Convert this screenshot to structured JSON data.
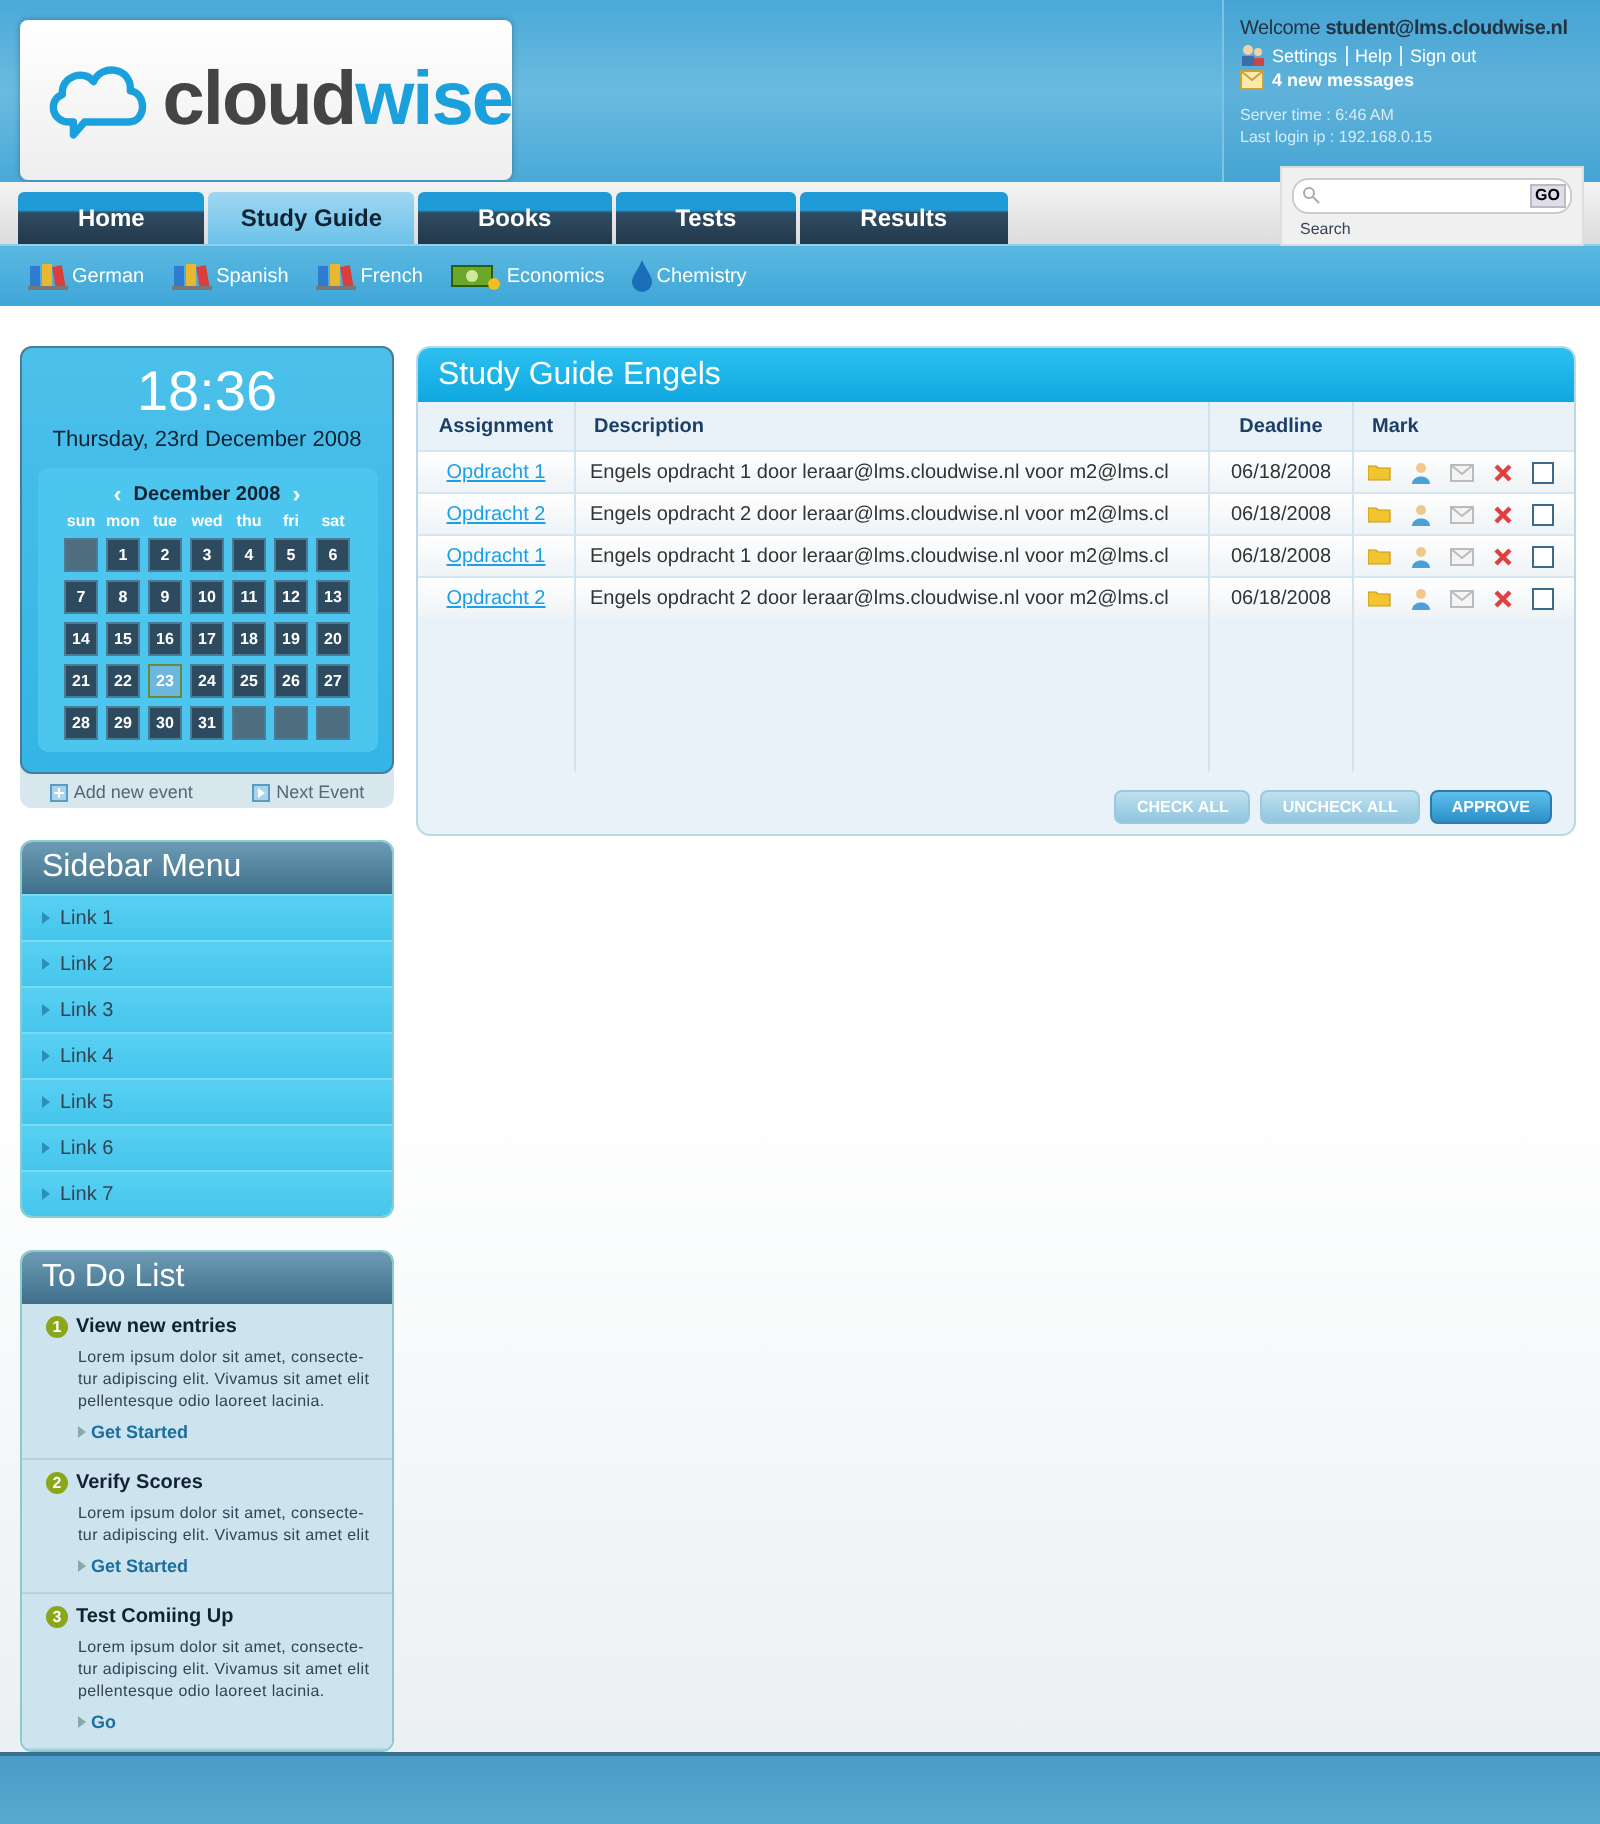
{
  "logo": {
    "part_1": "cloud",
    "part_2": "wise"
  },
  "user_panel": {
    "welcome": "Welcome",
    "user": "student@lms.cloudwise.nl",
    "links": [
      "Settings",
      "Help",
      "Sign out"
    ],
    "messages": "4 new messages",
    "server_time": "Server time : 6:46 AM",
    "last_login": "Last login ip : 192.168.0.15"
  },
  "search": {
    "button": "GO",
    "label": "Search"
  },
  "tabs": [
    {
      "label": "Home",
      "selected": false
    },
    {
      "label": "Study Guide",
      "selected": true
    },
    {
      "label": "Books",
      "selected": false
    },
    {
      "label": "Tests",
      "selected": false
    },
    {
      "label": "Results",
      "selected": false
    }
  ],
  "subjects": [
    {
      "label": "German",
      "kind": "books"
    },
    {
      "label": "Spanish",
      "kind": "books"
    },
    {
      "label": "French",
      "kind": "books"
    },
    {
      "label": "Economics",
      "kind": "money"
    },
    {
      "label": "Chemistry",
      "kind": "drop"
    }
  ],
  "clock": {
    "time": "18:36",
    "date": "Thursday, 23rd December 2008"
  },
  "calendar": {
    "prev": "‹",
    "month": "December 2008",
    "next": "›",
    "weekdays": [
      "sun",
      "mon",
      "tue",
      "wed",
      "thu",
      "fri",
      "sat"
    ],
    "days": [
      {
        "selected": false
      },
      {
        "day": "1",
        "selected": false
      },
      {
        "day": "2",
        "selected": false
      },
      {
        "day": "3",
        "selected": false
      },
      {
        "day": "4",
        "selected": false
      },
      {
        "day": "5",
        "selected": false
      },
      {
        "day": "6",
        "selected": false
      },
      {
        "day": "7",
        "selected": false
      },
      {
        "day": "8",
        "selected": false
      },
      {
        "day": "9",
        "selected": false
      },
      {
        "day": "10",
        "selected": false
      },
      {
        "day": "11",
        "selected": false
      },
      {
        "day": "12",
        "selected": false
      },
      {
        "day": "13",
        "selected": false
      },
      {
        "day": "14",
        "selected": false
      },
      {
        "day": "15",
        "selected": false
      },
      {
        "day": "16",
        "selected": false
      },
      {
        "day": "17",
        "selected": false
      },
      {
        "day": "18",
        "selected": false
      },
      {
        "day": "19",
        "selected": false
      },
      {
        "day": "20",
        "selected": false
      },
      {
        "day": "21",
        "selected": false
      },
      {
        "day": "22",
        "selected": false
      },
      {
        "day": "23",
        "selected": true
      },
      {
        "day": "24",
        "selected": false
      },
      {
        "day": "25",
        "selected": false
      },
      {
        "day": "26",
        "selected": false
      },
      {
        "day": "27",
        "selected": false
      },
      {
        "day": "28",
        "selected": false
      },
      {
        "day": "29",
        "selected": false
      },
      {
        "day": "30",
        "selected": false
      },
      {
        "day": "31",
        "selected": false
      },
      {
        "selected": false
      },
      {
        "selected": false
      },
      {
        "selected": false
      }
    ],
    "actions": [
      "Add new event",
      "Next Event"
    ]
  },
  "sidebar_menu": {
    "title": "Sidebar Menu",
    "items": [
      "Link 1",
      "Link 2",
      "Link 3",
      "Link 4",
      "Link 5",
      "Link 6",
      "Link 7"
    ]
  },
  "todo": {
    "title": "To Do List",
    "items": [
      {
        "number": "1",
        "title": "View new entries",
        "lines": [
          "Lorem ipsum dolor sit amet, consecte-",
          "tur adipiscing elit. Vivamus sit amet elit",
          "pellentesque odio laoreet lacinia."
        ],
        "link": "Get Started"
      },
      {
        "number": "2",
        "title": "Verify Scores",
        "lines": [
          "Lorem ipsum dolor sit amet, consecte-",
          "tur adipiscing elit. Vivamus sit amet elit"
        ],
        "link": "Get Started"
      },
      {
        "number": "3",
        "title": "Test Comiing Up",
        "lines": [
          "Lorem ipsum dolor sit amet, consecte-",
          "tur adipiscing elit. Vivamus sit amet elit",
          "pellentesque odio laoreet lacinia."
        ],
        "link": "Go"
      }
    ]
  },
  "study_guide": {
    "title": "Study Guide Engels",
    "columns": [
      "Assignment",
      "Description",
      "Deadline",
      "Mark"
    ],
    "rows": [
      {
        "assignment": "Opdracht 1",
        "description": "Engels opdracht 1 door leraar@lms.cloudwise.nl voor m2@lms.cl",
        "deadline": "06/18/2008",
        "checked": false
      },
      {
        "assignment": "Opdracht 2",
        "description": "Engels opdracht 2 door leraar@lms.cloudwise.nl voor m2@lms.cl",
        "deadline": "06/18/2008",
        "checked": false
      },
      {
        "assignment": "Opdracht 1",
        "description": "Engels opdracht 1 door leraar@lms.cloudwise.nl voor m2@lms.cl",
        "deadline": "06/18/2008",
        "checked": false
      },
      {
        "assignment": "Opdracht 2",
        "description": "Engels opdracht 2 door leraar@lms.cloudwise.nl voor m2@lms.cl",
        "deadline": "06/18/2008",
        "checked": false
      }
    ],
    "buttons": [
      {
        "label": "CHECK ALL",
        "kind": "light"
      },
      {
        "label": "UNCHECK ALL",
        "kind": "light"
      },
      {
        "label": "APPROVE",
        "kind": "dark"
      }
    ]
  }
}
